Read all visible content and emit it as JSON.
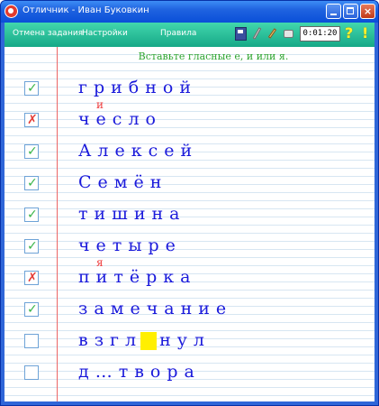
{
  "window": {
    "title": "Отличник - Иван Буковкин",
    "close_symbol": "×"
  },
  "toolbar": {
    "cancel_label": "Отмена задания",
    "settings_label": "Настройки",
    "rules_label": "Правила",
    "timer": "0:01:20",
    "help_label": "?",
    "exclaim_label": "!"
  },
  "task": {
    "instruction": "Вставьте гласные е, и или я."
  },
  "rows": [
    {
      "status": "correct",
      "word": "грибной"
    },
    {
      "status": "wrong",
      "word": "чесло",
      "correction": "и"
    },
    {
      "status": "correct",
      "word": "Алексей"
    },
    {
      "status": "correct",
      "word": "Семён"
    },
    {
      "status": "correct",
      "word": "тишина"
    },
    {
      "status": "correct",
      "word": "четыре"
    },
    {
      "status": "wrong",
      "word": "питёрка",
      "correction": "я"
    },
    {
      "status": "correct",
      "word": "замечание"
    },
    {
      "status": "empty",
      "word_before": "взгл",
      "word_after": "нул"
    },
    {
      "status": "empty",
      "word": "д…твора"
    }
  ],
  "icons": {
    "check": "check-icon",
    "wrong": "cross-icon"
  },
  "colors": {
    "toolbar": "#2bc39d",
    "correct": "#39b54a",
    "wrong": "#e43e38",
    "word": "#1a1adb",
    "instruction": "#2fa530",
    "highlight": "#ffef00"
  }
}
